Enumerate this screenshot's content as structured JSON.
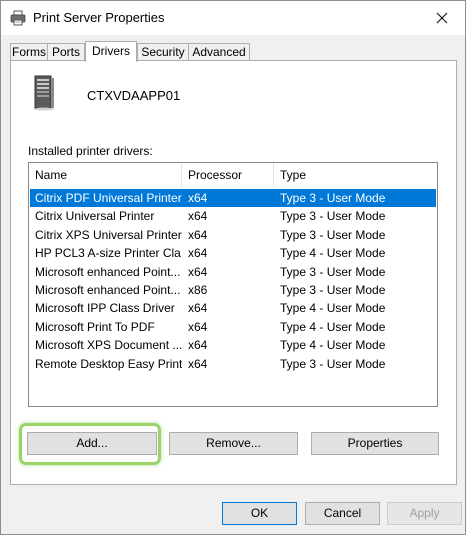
{
  "window": {
    "title": "Print Server Properties"
  },
  "tabs": [
    {
      "label": "Forms",
      "active": false
    },
    {
      "label": "Ports",
      "active": false
    },
    {
      "label": "Drivers",
      "active": true
    },
    {
      "label": "Security",
      "active": false
    },
    {
      "label": "Advanced",
      "active": false
    }
  ],
  "server": {
    "name": "CTXVDAAPP01"
  },
  "drivers_label": "Installed printer drivers:",
  "columns": [
    "Name",
    "Processor",
    "Type"
  ],
  "drivers": [
    {
      "name": "Citrix PDF Universal Printer",
      "processor": "x64",
      "type": "Type 3 - User Mode",
      "selected": true
    },
    {
      "name": "Citrix Universal Printer",
      "processor": "x64",
      "type": "Type 3 - User Mode"
    },
    {
      "name": "Citrix XPS Universal Printer",
      "processor": "x64",
      "type": "Type 3 - User Mode"
    },
    {
      "name": "HP PCL3 A-size Printer Cla...",
      "processor": "x64",
      "type": "Type 4 - User Mode"
    },
    {
      "name": "Microsoft enhanced Point...",
      "processor": "x64",
      "type": "Type 3 - User Mode"
    },
    {
      "name": "Microsoft enhanced Point...",
      "processor": "x86",
      "type": "Type 3 - User Mode"
    },
    {
      "name": "Microsoft IPP Class Driver",
      "processor": "x64",
      "type": "Type 4 - User Mode"
    },
    {
      "name": "Microsoft Print To PDF",
      "processor": "x64",
      "type": "Type 4 - User Mode"
    },
    {
      "name": "Microsoft XPS Document ...",
      "processor": "x64",
      "type": "Type 4 - User Mode"
    },
    {
      "name": "Remote Desktop Easy Print",
      "processor": "x64",
      "type": "Type 3 - User Mode"
    }
  ],
  "panel_buttons": {
    "add": "Add...",
    "remove": "Remove...",
    "properties": "Properties"
  },
  "dialog_buttons": {
    "ok": "OK",
    "cancel": "Cancel",
    "apply": "Apply"
  },
  "colors": {
    "selection": "#0078d7",
    "highlight_ring": "#9ad36a"
  }
}
